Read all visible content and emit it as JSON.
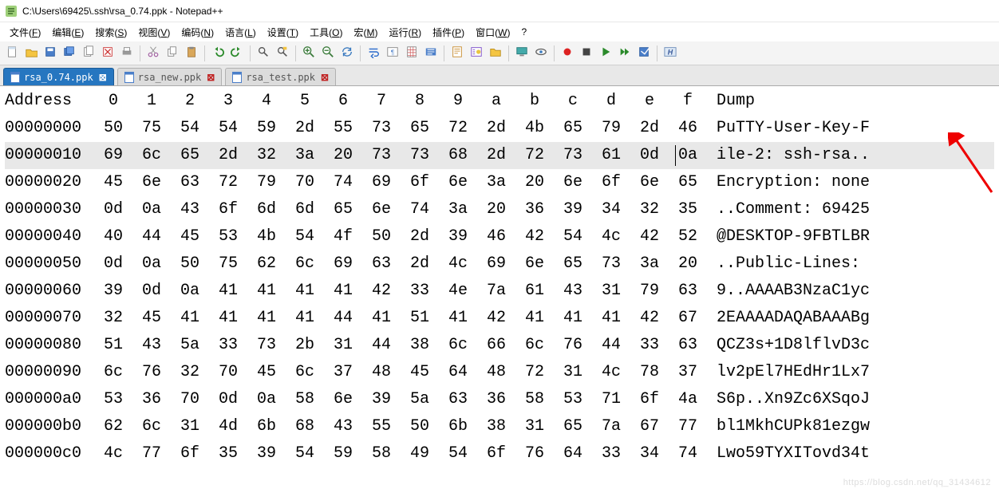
{
  "window": {
    "title": "C:\\Users\\69425\\.ssh\\rsa_0.74.ppk - Notepad++"
  },
  "menu": {
    "items": [
      {
        "label": "文件(F)",
        "hotkey": "F"
      },
      {
        "label": "编辑(E)",
        "hotkey": "E"
      },
      {
        "label": "搜索(S)",
        "hotkey": "S"
      },
      {
        "label": "视图(V)",
        "hotkey": "V"
      },
      {
        "label": "编码(N)",
        "hotkey": "N"
      },
      {
        "label": "语言(L)",
        "hotkey": "L"
      },
      {
        "label": "设置(T)",
        "hotkey": "T"
      },
      {
        "label": "工具(O)",
        "hotkey": "O"
      },
      {
        "label": "宏(M)",
        "hotkey": "M"
      },
      {
        "label": "运行(R)",
        "hotkey": "R"
      },
      {
        "label": "插件(P)",
        "hotkey": "P"
      },
      {
        "label": "窗口(W)",
        "hotkey": "W"
      },
      {
        "label": "?",
        "hotkey": ""
      }
    ]
  },
  "tabs": [
    {
      "name": "rsa_0.74.ppk",
      "active": true
    },
    {
      "name": "rsa_new.ppk",
      "active": false
    },
    {
      "name": "rsa_test.ppk",
      "active": false
    }
  ],
  "hex": {
    "address_header": "Address",
    "col_headers": [
      "0",
      "1",
      "2",
      "3",
      "4",
      "5",
      "6",
      "7",
      "8",
      "9",
      "a",
      "b",
      "c",
      "d",
      "e",
      "f"
    ],
    "dump_header": "Dump",
    "rows": [
      {
        "addr": "00000000",
        "bytes": [
          "50",
          "75",
          "54",
          "54",
          "59",
          "2d",
          "55",
          "73",
          "65",
          "72",
          "2d",
          "4b",
          "65",
          "79",
          "2d",
          "46"
        ],
        "dump": "PuTTY-User-Key-F"
      },
      {
        "addr": "00000010",
        "bytes": [
          "69",
          "6c",
          "65",
          "2d",
          "32",
          "3a",
          "20",
          "73",
          "73",
          "68",
          "2d",
          "72",
          "73",
          "61",
          "0d",
          "0a"
        ],
        "dump": "ile-2: ssh-rsa..",
        "hl": true,
        "caret_before": 15
      },
      {
        "addr": "00000020",
        "bytes": [
          "45",
          "6e",
          "63",
          "72",
          "79",
          "70",
          "74",
          "69",
          "6f",
          "6e",
          "3a",
          "20",
          "6e",
          "6f",
          "6e",
          "65"
        ],
        "dump": "Encryption: none"
      },
      {
        "addr": "00000030",
        "bytes": [
          "0d",
          "0a",
          "43",
          "6f",
          "6d",
          "6d",
          "65",
          "6e",
          "74",
          "3a",
          "20",
          "36",
          "39",
          "34",
          "32",
          "35"
        ],
        "dump": "..Comment: 69425"
      },
      {
        "addr": "00000040",
        "bytes": [
          "40",
          "44",
          "45",
          "53",
          "4b",
          "54",
          "4f",
          "50",
          "2d",
          "39",
          "46",
          "42",
          "54",
          "4c",
          "42",
          "52"
        ],
        "dump": "@DESKTOP-9FBTLBR"
      },
      {
        "addr": "00000050",
        "bytes": [
          "0d",
          "0a",
          "50",
          "75",
          "62",
          "6c",
          "69",
          "63",
          "2d",
          "4c",
          "69",
          "6e",
          "65",
          "73",
          "3a",
          "20"
        ],
        "dump": "..Public-Lines: "
      },
      {
        "addr": "00000060",
        "bytes": [
          "39",
          "0d",
          "0a",
          "41",
          "41",
          "41",
          "41",
          "42",
          "33",
          "4e",
          "7a",
          "61",
          "43",
          "31",
          "79",
          "63"
        ],
        "dump": "9..AAAAB3NzaC1yc"
      },
      {
        "addr": "00000070",
        "bytes": [
          "32",
          "45",
          "41",
          "41",
          "41",
          "41",
          "44",
          "41",
          "51",
          "41",
          "42",
          "41",
          "41",
          "41",
          "42",
          "67"
        ],
        "dump": "2EAAAADAQABAAABg"
      },
      {
        "addr": "00000080",
        "bytes": [
          "51",
          "43",
          "5a",
          "33",
          "73",
          "2b",
          "31",
          "44",
          "38",
          "6c",
          "66",
          "6c",
          "76",
          "44",
          "33",
          "63"
        ],
        "dump": "QCZ3s+1D8lflvD3c"
      },
      {
        "addr": "00000090",
        "bytes": [
          "6c",
          "76",
          "32",
          "70",
          "45",
          "6c",
          "37",
          "48",
          "45",
          "64",
          "48",
          "72",
          "31",
          "4c",
          "78",
          "37"
        ],
        "dump": "lv2pEl7HEdHr1Lx7"
      },
      {
        "addr": "000000a0",
        "bytes": [
          "53",
          "36",
          "70",
          "0d",
          "0a",
          "58",
          "6e",
          "39",
          "5a",
          "63",
          "36",
          "58",
          "53",
          "71",
          "6f",
          "4a"
        ],
        "dump": "S6p..Xn9Zc6XSqoJ"
      },
      {
        "addr": "000000b0",
        "bytes": [
          "62",
          "6c",
          "31",
          "4d",
          "6b",
          "68",
          "43",
          "55",
          "50",
          "6b",
          "38",
          "31",
          "65",
          "7a",
          "67",
          "77"
        ],
        "dump": "bl1MkhCUPk81ezgw"
      },
      {
        "addr": "000000c0",
        "bytes": [
          "4c",
          "77",
          "6f",
          "35",
          "39",
          "54",
          "59",
          "58",
          "49",
          "54",
          "6f",
          "76",
          "64",
          "33",
          "34",
          "74"
        ],
        "dump": "Lwo59TYXITovd34t"
      }
    ]
  },
  "toolbar": {
    "icons": [
      "new-file",
      "open-file",
      "save",
      "save-all",
      "copy-file",
      "close",
      "print",
      "sep",
      "cut",
      "copy",
      "paste",
      "sep",
      "undo",
      "redo",
      "sep",
      "find",
      "replace",
      "sep",
      "zoom-in",
      "zoom-out",
      "sync",
      "sep",
      "word-wrap",
      "show-all",
      "guide",
      "lang",
      "sep",
      "doc-map",
      "func-list",
      "folder",
      "sep",
      "monitor",
      "eye",
      "sep",
      "record",
      "stop",
      "play",
      "fast-play",
      "save-macro",
      "sep",
      "hex-badge"
    ]
  },
  "watermark": "https://blog.csdn.net/qq_31434612"
}
